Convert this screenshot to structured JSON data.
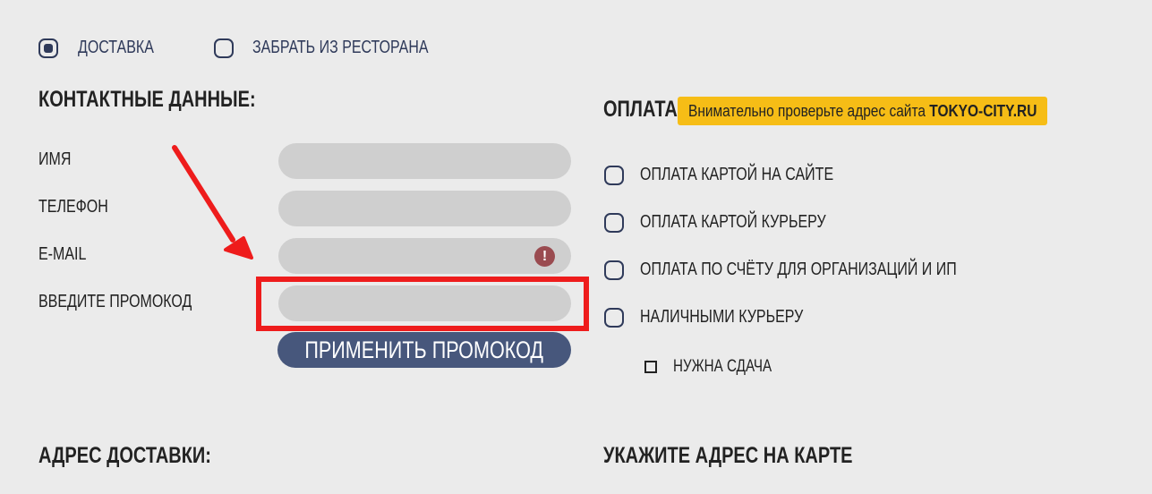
{
  "delivery": {
    "options": [
      {
        "label": "ДОСТАВКА",
        "checked": true
      },
      {
        "label": "ЗАБРАТЬ ИЗ РЕСТОРАНА",
        "checked": false
      }
    ]
  },
  "contacts": {
    "title": "КОНТАКТНЫЕ ДАННЫЕ:",
    "fields": [
      {
        "label": "ИМЯ",
        "value": ""
      },
      {
        "label": "ТЕЛЕФОН",
        "value": ""
      },
      {
        "label": "E-MAIL",
        "value": "",
        "error": true
      },
      {
        "label": "ВВЕДИТЕ ПРОМОКОД",
        "value": ""
      }
    ],
    "apply_button": "ПРИМЕНИТЬ ПРОМОКОД"
  },
  "payment": {
    "title": "ОПЛАТА:",
    "notice_text": "Внимательно проверьте адрес сайта ",
    "notice_site": "TOKYO-CITY.RU",
    "options": [
      {
        "label": "ОПЛАТА КАРТОЙ НА САЙТЕ",
        "checked": false
      },
      {
        "label": "ОПЛАТА КАРТОЙ КУРЬЕРУ",
        "checked": false
      },
      {
        "label": "ОПЛАТА ПО СЧЁТУ ДЛЯ ОРГАНИЗАЦИЙ И ИП",
        "checked": false
      },
      {
        "label": "НАЛИЧНЫМИ КУРЬЕРУ",
        "checked": false
      }
    ],
    "change": {
      "label": "НУЖНА СДАЧА",
      "checked": false
    }
  },
  "address": {
    "title": "АДРЕС ДОСТАВКИ:",
    "map_title": "УКАЖИТЕ АДРЕС НА КАРТЕ"
  },
  "icons": {
    "error": "error-icon",
    "arrow": "red-arrow-annotation"
  },
  "colors": {
    "background": "#ebebeb",
    "accent": "#47577c",
    "notice": "#f6bd16",
    "highlight": "#ee1c1c",
    "error": "#9a4b50"
  }
}
